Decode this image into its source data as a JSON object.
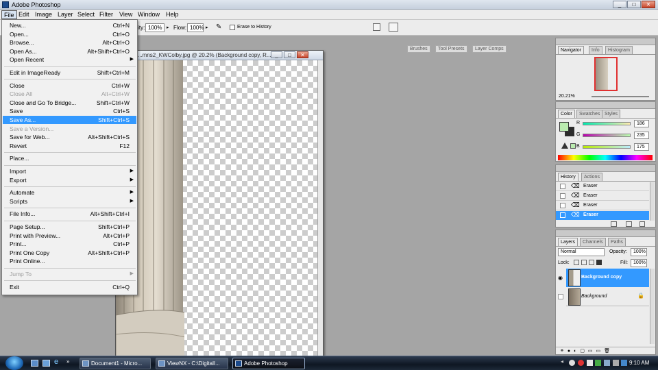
{
  "app": {
    "title": "Adobe Photoshop"
  },
  "menubar": [
    "File",
    "Edit",
    "Image",
    "Layer",
    "Select",
    "Filter",
    "View",
    "Window",
    "Help"
  ],
  "options": {
    "opacity_label": "Opacity:",
    "opacity_value": "100%",
    "flow_label": "Flow:",
    "flow_value": "100%",
    "erase_history": "Erase to History",
    "tabs": [
      "Brushes",
      "Tool Presets",
      "Layer Comps"
    ]
  },
  "document": {
    "title": "...mns2_KWColby.jpg @ 20.2% (Background copy, R..."
  },
  "file_menu": {
    "items": [
      {
        "label": "New...",
        "shortcut": "Ctrl+N"
      },
      {
        "label": "Open...",
        "shortcut": "Ctrl+O"
      },
      {
        "label": "Browse...",
        "shortcut": "Alt+Ctrl+O"
      },
      {
        "label": "Open As...",
        "shortcut": "Alt+Shift+Ctrl+O"
      },
      {
        "label": "Open Recent",
        "shortcut": "▶"
      },
      {
        "label": "Edit in ImageReady",
        "shortcut": "Shift+Ctrl+M"
      },
      {
        "label": "Close",
        "shortcut": "Ctrl+W"
      },
      {
        "label": "Close All",
        "shortcut": "Alt+Ctrl+W",
        "disabled": true
      },
      {
        "label": "Close and Go To Bridge...",
        "shortcut": "Shift+Ctrl+W"
      },
      {
        "label": "Save",
        "shortcut": "Ctrl+S"
      },
      {
        "label": "Save As...",
        "shortcut": "Shift+Ctrl+S",
        "highlighted": true
      },
      {
        "label": "Save a Version...",
        "shortcut": "",
        "disabled": true
      },
      {
        "label": "Save for Web...",
        "shortcut": "Alt+Shift+Ctrl+S"
      },
      {
        "label": "Revert",
        "shortcut": "F12"
      },
      {
        "label": "Place...",
        "shortcut": ""
      },
      {
        "label": "Import",
        "shortcut": "▶"
      },
      {
        "label": "Export",
        "shortcut": "▶"
      },
      {
        "label": "Automate",
        "shortcut": "▶"
      },
      {
        "label": "Scripts",
        "shortcut": "▶"
      },
      {
        "label": "File Info...",
        "shortcut": "Alt+Shift+Ctrl+I"
      },
      {
        "label": "Page Setup...",
        "shortcut": "Shift+Ctrl+P"
      },
      {
        "label": "Print with Preview...",
        "shortcut": "Alt+Ctrl+P"
      },
      {
        "label": "Print...",
        "shortcut": "Ctrl+P"
      },
      {
        "label": "Print One Copy",
        "shortcut": "Alt+Shift+Ctrl+P"
      },
      {
        "label": "Print Online...",
        "shortcut": ""
      },
      {
        "label": "Jump To",
        "shortcut": "▶",
        "disabled": true
      },
      {
        "label": "Exit",
        "shortcut": "Ctrl+Q"
      }
    ]
  },
  "navigator": {
    "tabs": [
      "Navigator",
      "Info",
      "Histogram"
    ],
    "zoom": "20.21%"
  },
  "color": {
    "tabs": [
      "Color",
      "Swatches",
      "Styles"
    ],
    "r_label": "R",
    "g_label": "G",
    "b_label": "B",
    "r": "186",
    "g": "235",
    "b": "175"
  },
  "history": {
    "tabs": [
      "History",
      "Actions"
    ],
    "items": [
      "Eraser",
      "Eraser",
      "Eraser",
      "Eraser"
    ]
  },
  "layers": {
    "tabs": [
      "Layers",
      "Channels",
      "Paths"
    ],
    "blend": "Normal",
    "opacity_label": "Opacity:",
    "opacity": "100%",
    "lock_label": "Lock:",
    "fill_label": "Fill:",
    "fill": "100%",
    "items": [
      "Background copy",
      "Background"
    ]
  },
  "taskbar": {
    "buttons": [
      "Document1 - Micro...",
      "ViewNX - C:\\DigitalI...",
      "Adobe Photoshop"
    ],
    "time": "9:10 AM"
  },
  "colors": {
    "accent": "#3399ff",
    "fg_swatch": "#baebaf"
  }
}
